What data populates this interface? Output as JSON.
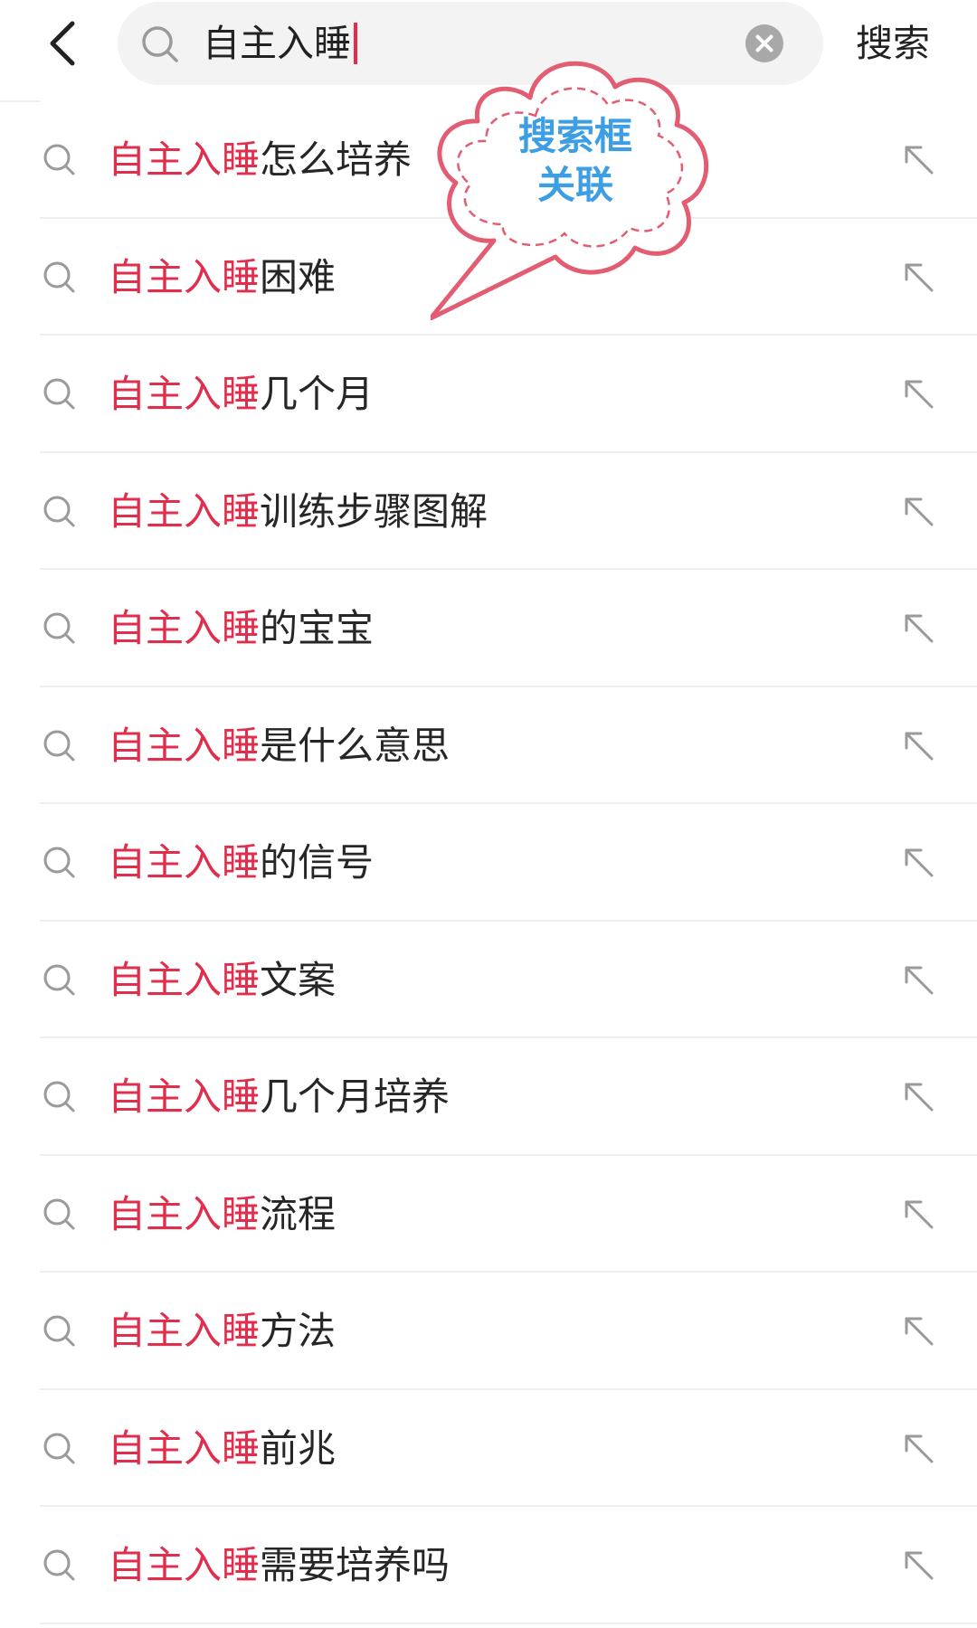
{
  "header": {
    "query": "自主入睡",
    "search_label": "搜索",
    "icons": {
      "back": "chevron-left-icon",
      "search": "search-icon",
      "clear": "clear-circle-icon"
    }
  },
  "suggestions": [
    {
      "highlight": "自主入睡",
      "rest": "怎么培养"
    },
    {
      "highlight": "自主入睡",
      "rest": "困难"
    },
    {
      "highlight": "自主入睡",
      "rest": "几个月"
    },
    {
      "highlight": "自主入睡",
      "rest": "训练步骤图解"
    },
    {
      "highlight": "自主入睡",
      "rest": "的宝宝"
    },
    {
      "highlight": "自主入睡",
      "rest": "是什么意思"
    },
    {
      "highlight": "自主入睡",
      "rest": "的信号"
    },
    {
      "highlight": "自主入睡",
      "rest": "文案"
    },
    {
      "highlight": "自主入睡",
      "rest": "几个月培养"
    },
    {
      "highlight": "自主入睡",
      "rest": "流程"
    },
    {
      "highlight": "自主入睡",
      "rest": "方法"
    },
    {
      "highlight": "自主入睡",
      "rest": "前兆"
    },
    {
      "highlight": "自主入睡",
      "rest": "需要培养吗"
    }
  ],
  "annotation": {
    "line1": "搜索框",
    "line2": "关联",
    "text_color": "#3d9ee4",
    "border_color": "#e35d72"
  },
  "colors": {
    "highlight": "#e02e4c",
    "caret": "#e8294a",
    "search_bg": "#f3f3f3",
    "icon_gray": "#9a9a9a"
  }
}
